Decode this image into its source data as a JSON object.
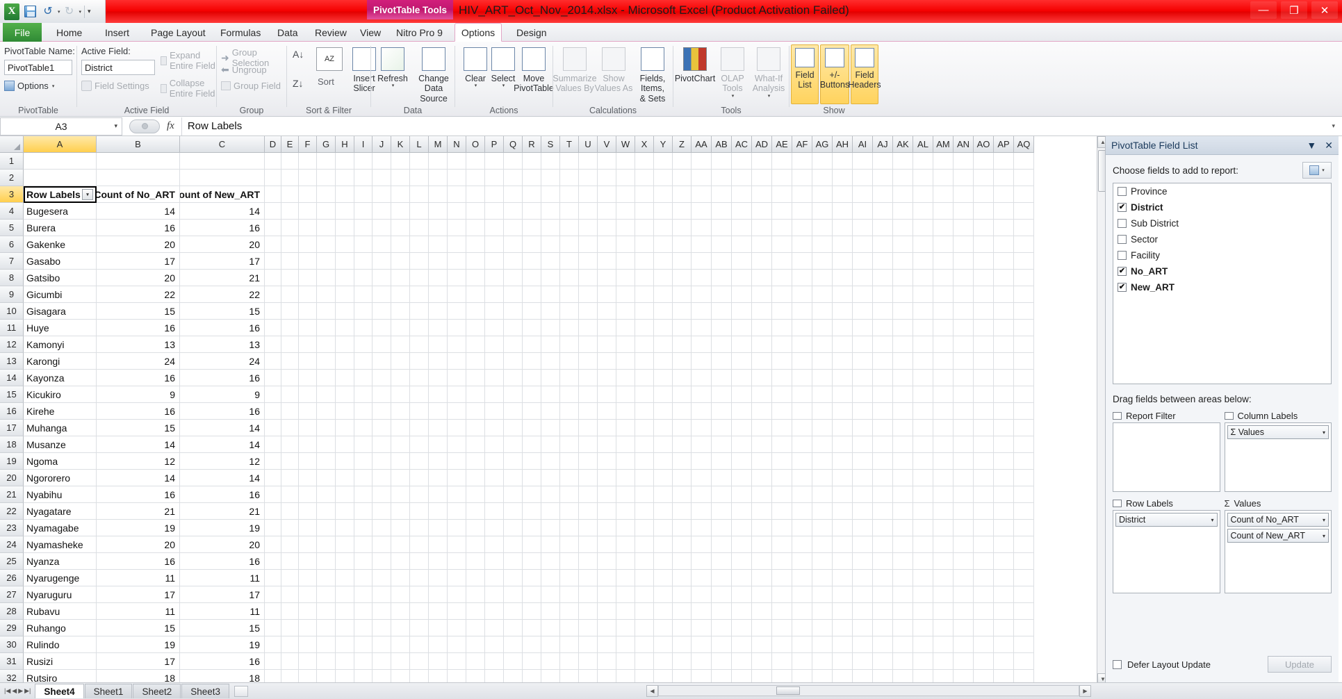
{
  "window": {
    "document_title": "HIV_ART_Oct_Nov_2014.xlsx - Microsoft Excel (Product Activation Failed)",
    "context_tab_label": "PivotTable Tools",
    "minimize": "—",
    "maximize": "❐",
    "close": "✕"
  },
  "quick_access": {
    "excel_logo": "X",
    "save_icon": "save-icon",
    "undo_icon": "↺",
    "redo_icon": "↻",
    "customize_icon": "▾"
  },
  "ribbon_tabs": [
    {
      "label": "File",
      "active": false
    },
    {
      "label": "Home",
      "active": false
    },
    {
      "label": "Insert",
      "active": false
    },
    {
      "label": "Page Layout",
      "active": false
    },
    {
      "label": "Formulas",
      "active": false
    },
    {
      "label": "Data",
      "active": false
    },
    {
      "label": "Review",
      "active": false
    },
    {
      "label": "View",
      "active": false
    },
    {
      "label": "Nitro Pro 9",
      "active": false
    },
    {
      "label": "Options",
      "active": true
    },
    {
      "label": "Design",
      "active": false
    }
  ],
  "ribbon": {
    "groups": [
      {
        "title": "PivotTable"
      },
      {
        "title": "Active Field"
      },
      {
        "title": "Group"
      },
      {
        "title": "Sort & Filter"
      },
      {
        "title": "Data"
      },
      {
        "title": "Actions"
      },
      {
        "title": "Calculations"
      },
      {
        "title": "Tools"
      },
      {
        "title": "Show"
      }
    ],
    "pivottable": {
      "name_label": "PivotTable Name:",
      "name_value": "PivotTable1",
      "options_label": "Options"
    },
    "active_field": {
      "label": "Active Field:",
      "value": "District",
      "field_settings": "Field Settings",
      "expand_entire": "Expand Entire Field",
      "collapse_entire": "Collapse Entire Field"
    },
    "group": {
      "group_selection": "Group Selection",
      "ungroup": "Ungroup",
      "group_field": "Group Field"
    },
    "sort_filter": {
      "sort": "Sort",
      "sort_az": "A→Z",
      "sort_za": "Z→A",
      "insert_slicer": "Insert\nSlicer"
    },
    "data": {
      "refresh": "Refresh",
      "change_data_source": "Change Data\nSource"
    },
    "actions": {
      "clear": "Clear",
      "select": "Select",
      "move_pivottable": "Move\nPivotTable"
    },
    "calculations": {
      "summarize_values_by": "Summarize\nValues By",
      "show_values_as": "Show\nValues As",
      "fields_items_sets": "Fields, Items,\n& Sets"
    },
    "tools": {
      "pivotchart": "PivotChart",
      "olap_tools": "OLAP\nTools",
      "what_if_analysis": "What-If\nAnalysis"
    },
    "show": {
      "field_list": "Field\nList",
      "plus_minus_buttons": "+/-\nButtons",
      "field_headers": "Field\nHeaders"
    }
  },
  "formula_bar": {
    "name_box": "A3",
    "fx_label": "fx",
    "content": "Row Labels"
  },
  "grid": {
    "columns": [
      "A",
      "B",
      "C",
      "D",
      "E",
      "F",
      "G",
      "H",
      "I",
      "J",
      "K",
      "L",
      "M",
      "N",
      "O",
      "P",
      "Q",
      "R",
      "S",
      "T",
      "U",
      "V",
      "W",
      "X",
      "Y",
      "Z",
      "AA",
      "AB",
      "AC",
      "AD",
      "AE",
      "AF",
      "AG",
      "AH",
      "AI",
      "AJ",
      "AK",
      "AL",
      "AM",
      "AN",
      "AO",
      "AP",
      "AQ"
    ],
    "selected_column": "A",
    "selected_row": 3,
    "headers": {
      "row_labels": "Row Labels",
      "count_no_art": "Count of No_ART",
      "count_new_art": "Count of New_ART"
    },
    "rows": [
      {
        "n": 1,
        "a": "",
        "b": "",
        "c": ""
      },
      {
        "n": 2,
        "a": "",
        "b": "",
        "c": ""
      },
      {
        "n": 3,
        "a": "Row Labels",
        "b": "Count of No_ART",
        "c": "Count of New_ART",
        "header": true
      },
      {
        "n": 4,
        "a": "Bugesera",
        "b": "14",
        "c": "14"
      },
      {
        "n": 5,
        "a": "Burera",
        "b": "16",
        "c": "16"
      },
      {
        "n": 6,
        "a": "Gakenke",
        "b": "20",
        "c": "20"
      },
      {
        "n": 7,
        "a": "Gasabo",
        "b": "17",
        "c": "17"
      },
      {
        "n": 8,
        "a": "Gatsibo",
        "b": "20",
        "c": "21"
      },
      {
        "n": 9,
        "a": "Gicumbi",
        "b": "22",
        "c": "22"
      },
      {
        "n": 10,
        "a": "Gisagara",
        "b": "15",
        "c": "15"
      },
      {
        "n": 11,
        "a": "Huye",
        "b": "16",
        "c": "16"
      },
      {
        "n": 12,
        "a": "Kamonyi",
        "b": "13",
        "c": "13"
      },
      {
        "n": 13,
        "a": "Karongi",
        "b": "24",
        "c": "24"
      },
      {
        "n": 14,
        "a": "Kayonza",
        "b": "16",
        "c": "16"
      },
      {
        "n": 15,
        "a": "Kicukiro",
        "b": "9",
        "c": "9"
      },
      {
        "n": 16,
        "a": "Kirehe",
        "b": "16",
        "c": "16"
      },
      {
        "n": 17,
        "a": "Muhanga",
        "b": "15",
        "c": "14"
      },
      {
        "n": 18,
        "a": "Musanze",
        "b": "14",
        "c": "14"
      },
      {
        "n": 19,
        "a": "Ngoma",
        "b": "12",
        "c": "12"
      },
      {
        "n": 20,
        "a": "Ngororero",
        "b": "14",
        "c": "14"
      },
      {
        "n": 21,
        "a": "Nyabihu",
        "b": "16",
        "c": "16"
      },
      {
        "n": 22,
        "a": "Nyagatare",
        "b": "21",
        "c": "21"
      },
      {
        "n": 23,
        "a": "Nyamagabe",
        "b": "19",
        "c": "19"
      },
      {
        "n": 24,
        "a": "Nyamasheke",
        "b": "20",
        "c": "20"
      },
      {
        "n": 25,
        "a": "Nyanza",
        "b": "16",
        "c": "16"
      },
      {
        "n": 26,
        "a": "Nyarugenge",
        "b": "11",
        "c": "11"
      },
      {
        "n": 27,
        "a": "Nyaruguru",
        "b": "17",
        "c": "17"
      },
      {
        "n": 28,
        "a": "Rubavu",
        "b": "11",
        "c": "11"
      },
      {
        "n": 29,
        "a": "Ruhango",
        "b": "15",
        "c": "15"
      },
      {
        "n": 30,
        "a": "Rulindo",
        "b": "19",
        "c": "19"
      },
      {
        "n": 31,
        "a": "Rusizi",
        "b": "17",
        "c": "16"
      },
      {
        "n": 32,
        "a": "Rutsiro",
        "b": "18",
        "c": "18"
      }
    ]
  },
  "field_list": {
    "title": "PivotTable Field List",
    "collapse_icon": "▼",
    "close_icon": "✕",
    "choose_label": "Choose fields to add to report:",
    "sort_button_icon": "field-sort-icon",
    "fields": [
      {
        "label": "Province",
        "checked": false
      },
      {
        "label": "District",
        "checked": true
      },
      {
        "label": "Sub District",
        "checked": false
      },
      {
        "label": "Sector",
        "checked": false
      },
      {
        "label": "Facility",
        "checked": false
      },
      {
        "label": "No_ART",
        "checked": true
      },
      {
        "label": "New_ART",
        "checked": true
      }
    ],
    "drag_label": "Drag fields between areas below:",
    "areas": {
      "report_filter": {
        "title": "Report Filter",
        "items": []
      },
      "column_labels": {
        "title": "Column Labels",
        "items": [
          "Σ Values"
        ]
      },
      "row_labels": {
        "title": "Row Labels",
        "items": [
          "District"
        ]
      },
      "values": {
        "title": "Values",
        "items": [
          "Count of No_ART",
          "Count of New_ART"
        ]
      }
    },
    "defer_label": "Defer Layout Update",
    "update_button": "Update",
    "check_mark": "✔"
  },
  "sheet_tabs": {
    "tabs": [
      {
        "label": "Sheet4",
        "active": true
      },
      {
        "label": "Sheet1",
        "active": false
      },
      {
        "label": "Sheet2",
        "active": false
      },
      {
        "label": "Sheet3",
        "active": false
      }
    ],
    "new_sheet_icon": "new-sheet-icon",
    "nav_first": "|◀",
    "nav_prev": "◀",
    "nav_next": "▶",
    "nav_last": "▶|"
  },
  "colors": {
    "title_red": "#ee0000",
    "context_pink": "#d21f7c",
    "file_green": "#3f9a3d",
    "selected_yellow": "#ffd35e"
  }
}
